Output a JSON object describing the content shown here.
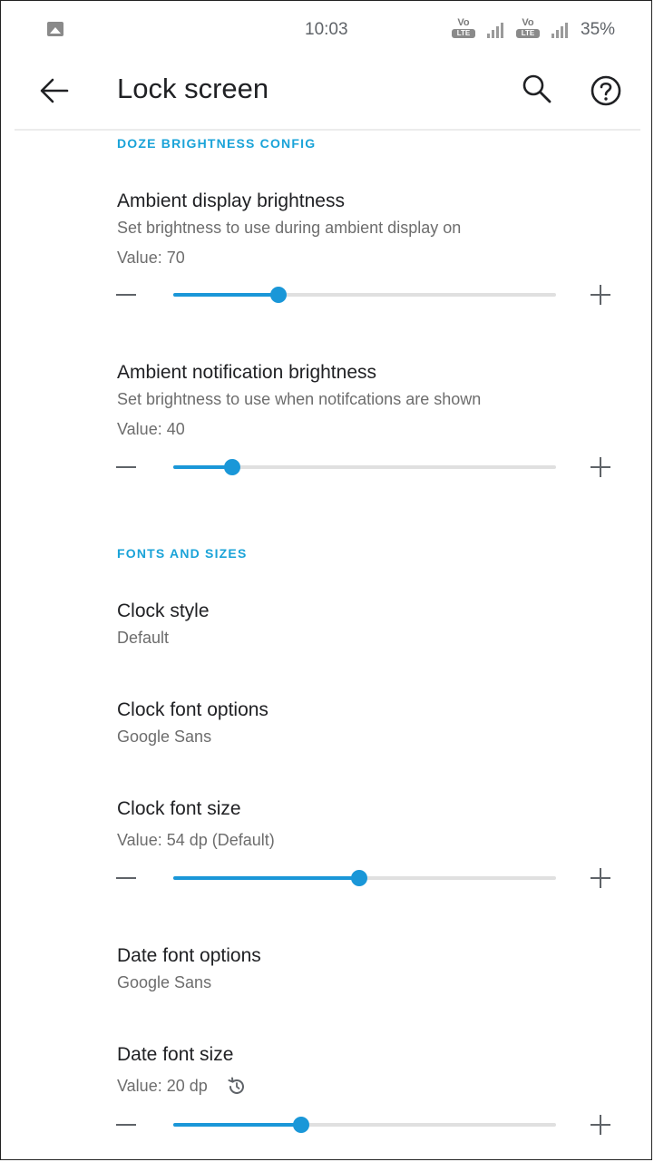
{
  "status_bar": {
    "time": "10:03",
    "network1_label": "Vo",
    "network1_sub": "LTE",
    "network2_label": "Vo",
    "network2_sub": "LTE",
    "battery": "35%"
  },
  "app_bar": {
    "title": "Lock screen"
  },
  "sections": [
    {
      "header": "DOZE BRIGHTNESS CONFIG"
    },
    {
      "header": "FONTS AND SIZES"
    }
  ],
  "prefs": {
    "ambient_display": {
      "title": "Ambient display brightness",
      "summary": "Set brightness to use during ambient display on",
      "value_text": "Value: 70",
      "slider_fraction": 0.275
    },
    "ambient_notification": {
      "title": "Ambient notification brightness",
      "summary": "Set brightness to use when notifcations are shown",
      "value_text": "Value: 40",
      "slider_fraction": 0.153
    },
    "clock_style": {
      "title": "Clock style",
      "summary": "Default"
    },
    "clock_font_options": {
      "title": "Clock font options",
      "summary": "Google Sans"
    },
    "clock_font_size": {
      "title": "Clock font size",
      "value_text": "Value: 54 dp (Default)",
      "slider_fraction": 0.485
    },
    "date_font_options": {
      "title": "Date font options",
      "summary": "Google Sans"
    },
    "date_font_size": {
      "title": "Date font size",
      "value_text": "Value: 20 dp",
      "slider_fraction": 0.335
    }
  },
  "colors": {
    "accent": "#1a97d8",
    "section_header": "#1aa3d8",
    "track": "#e0e0e0"
  },
  "icons": [
    "gallery-icon",
    "back-arrow-icon",
    "search-icon",
    "help-icon",
    "minus-icon",
    "plus-icon",
    "reset-icon"
  ]
}
